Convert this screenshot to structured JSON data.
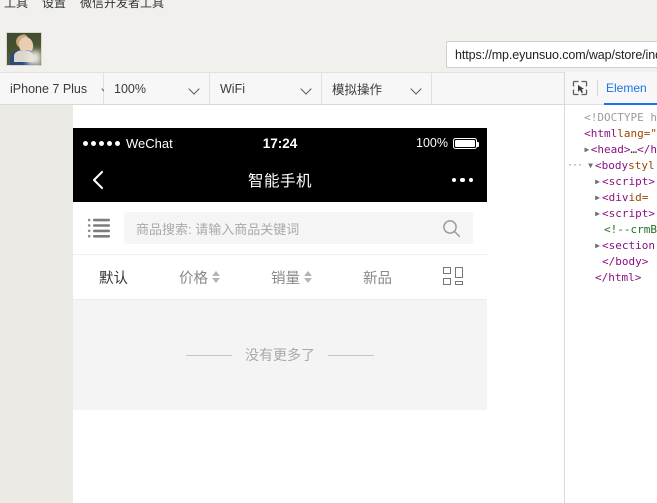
{
  "app_menu": {
    "items": [
      "工具",
      "设置",
      "微信开发者工具"
    ]
  },
  "header": {
    "avatar_alt": "user-avatar",
    "url": "https://mp.eyunsuo.com/wap/store/ind"
  },
  "toolbar": {
    "device": "iPhone 7 Plus",
    "zoom": "100%",
    "network": "WiFi",
    "simulate": "模拟操作",
    "icons": [
      "separate-window-icon",
      "send-to-device-icon"
    ]
  },
  "devtools": {
    "inspect_icon": "inspect-cursor-icon",
    "tab": "Elemen",
    "tree": [
      {
        "indent": 1,
        "arrow": "",
        "dots": false,
        "parts": [
          {
            "t": "doctype",
            "v": "<!DOCTYPE h"
          }
        ]
      },
      {
        "indent": 1,
        "arrow": "",
        "dots": false,
        "parts": [
          {
            "t": "tag",
            "v": "<html "
          },
          {
            "t": "attr",
            "v": "lang=\""
          }
        ]
      },
      {
        "indent": 1,
        "arrow": "▶",
        "dots": false,
        "parts": [
          {
            "t": "tag",
            "v": "<head>"
          },
          {
            "t": "plain",
            "v": "…"
          },
          {
            "t": "tag",
            "v": "</h"
          }
        ]
      },
      {
        "indent": 1,
        "arrow": "▼",
        "dots": true,
        "parts": [
          {
            "t": "tag",
            "v": "<body "
          },
          {
            "t": "attr",
            "v": "styl"
          }
        ]
      },
      {
        "indent": 2,
        "arrow": "▶",
        "dots": false,
        "parts": [
          {
            "t": "tag",
            "v": "<script>"
          }
        ]
      },
      {
        "indent": 2,
        "arrow": "▶",
        "dots": false,
        "parts": [
          {
            "t": "tag",
            "v": "<div "
          },
          {
            "t": "attr",
            "v": "id="
          }
        ]
      },
      {
        "indent": 2,
        "arrow": "▶",
        "dots": false,
        "parts": [
          {
            "t": "tag",
            "v": "<script>"
          }
        ]
      },
      {
        "indent": 3,
        "arrow": "",
        "dots": false,
        "parts": [
          {
            "t": "comment",
            "v": "<!--crmB"
          }
        ]
      },
      {
        "indent": 2,
        "arrow": "▶",
        "dots": false,
        "parts": [
          {
            "t": "tag",
            "v": "<section"
          }
        ]
      },
      {
        "indent": 2,
        "arrow": "",
        "dots": false,
        "parts": [
          {
            "t": "tag",
            "v": "</body>"
          }
        ]
      },
      {
        "indent": 1,
        "arrow": "",
        "dots": false,
        "parts": [
          {
            "t": "tag",
            "v": "</html>"
          }
        ]
      }
    ]
  },
  "phone": {
    "statusbar": {
      "signal_dots": 5,
      "carrier": "WeChat",
      "time": "17:24",
      "battery_percent": "100%"
    },
    "navbar": {
      "back_icon": "chevron-left-icon",
      "title": "智能手机",
      "more_icon": "more-dots-icon"
    },
    "search": {
      "category_icon": "category-list-icon",
      "placeholder": "商品搜索: 请输入商品关键词",
      "value": "",
      "search_icon": "magnifier-icon"
    },
    "filters": [
      {
        "label": "默认",
        "sortable": false,
        "active": true
      },
      {
        "label": "价格",
        "sortable": true,
        "active": false
      },
      {
        "label": "销量",
        "sortable": true,
        "active": false
      },
      {
        "label": "新品",
        "sortable": false,
        "active": false
      }
    ],
    "layout_toggle_icon": "grid-layout-icon",
    "empty_state": "没有更多了"
  },
  "colors": {
    "chrome_bg": "#f1f0ec",
    "toolbar_bg": "#f7f7f7",
    "phone_black": "#000000",
    "list_bg": "#f4f4f4",
    "devtools_accent": "#1a73e8",
    "muted_text": "#a9a9a9"
  }
}
